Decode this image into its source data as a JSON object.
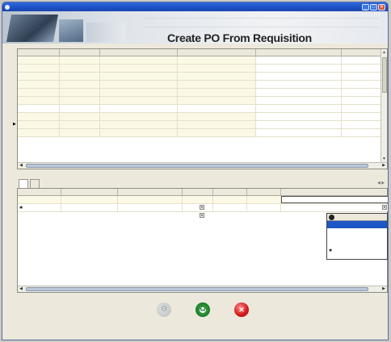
{
  "window": {
    "controls": {
      "minimize": "_",
      "maximize": "□",
      "close": "✕"
    }
  },
  "banner": {
    "heading": "Create PO From Requisition"
  },
  "requisitions": {
    "columns": [
      "",
      "",
      "",
      "",
      ""
    ],
    "rows": [
      [
        "",
        "",
        "",
        "",
        ""
      ],
      [
        "",
        "",
        "",
        "",
        ""
      ],
      [
        "",
        "",
        "",
        "",
        ""
      ],
      [
        "",
        "",
        "",
        "",
        ""
      ],
      [
        "",
        "",
        "",
        "",
        ""
      ],
      [
        "",
        "",
        "",
        "",
        ""
      ],
      [
        "",
        "",
        "",
        "",
        ""
      ],
      [
        "",
        "",
        "",
        "",
        ""
      ],
      [
        "",
        "",
        "",
        "",
        ""
      ],
      [
        "",
        "",
        "",
        "",
        ""
      ]
    ],
    "selected_row_marker": "▶",
    "scroll_up": "▲",
    "scroll_down": "▼",
    "scroll_left": "◀",
    "scroll_right": "▶"
  },
  "tabs": {
    "items": [
      {
        "label": "",
        "active": true
      },
      {
        "label": "",
        "active": false
      }
    ],
    "scroll": "◀ ▶"
  },
  "lines": {
    "columns": [
      "",
      "",
      "",
      "",
      "",
      "",
      ""
    ],
    "rows": [
      [
        "",
        "",
        "",
        "",
        "",
        "",
        ""
      ]
    ],
    "new_row": [
      "",
      "",
      "",
      "",
      "",
      "",
      ""
    ],
    "new_row_marker": "✱",
    "scroll_left": "◀",
    "scroll_right": "▶"
  },
  "lookup": {
    "column": "",
    "options": [
      "",
      ""
    ],
    "selected_index": 0,
    "new_marker": "✱"
  },
  "actions": {
    "process": "",
    "refresh": "",
    "close": ""
  },
  "colors": {
    "title_bar": "#1d4fc1",
    "row_fill": "#fbf9e6",
    "selection": "#1f56c6",
    "refresh": "#2f9b3a",
    "close": "#d51c1c"
  },
  "icons": {
    "process": "gear-icon",
    "refresh": "recycle-icon",
    "close": "close-circle-icon"
  }
}
